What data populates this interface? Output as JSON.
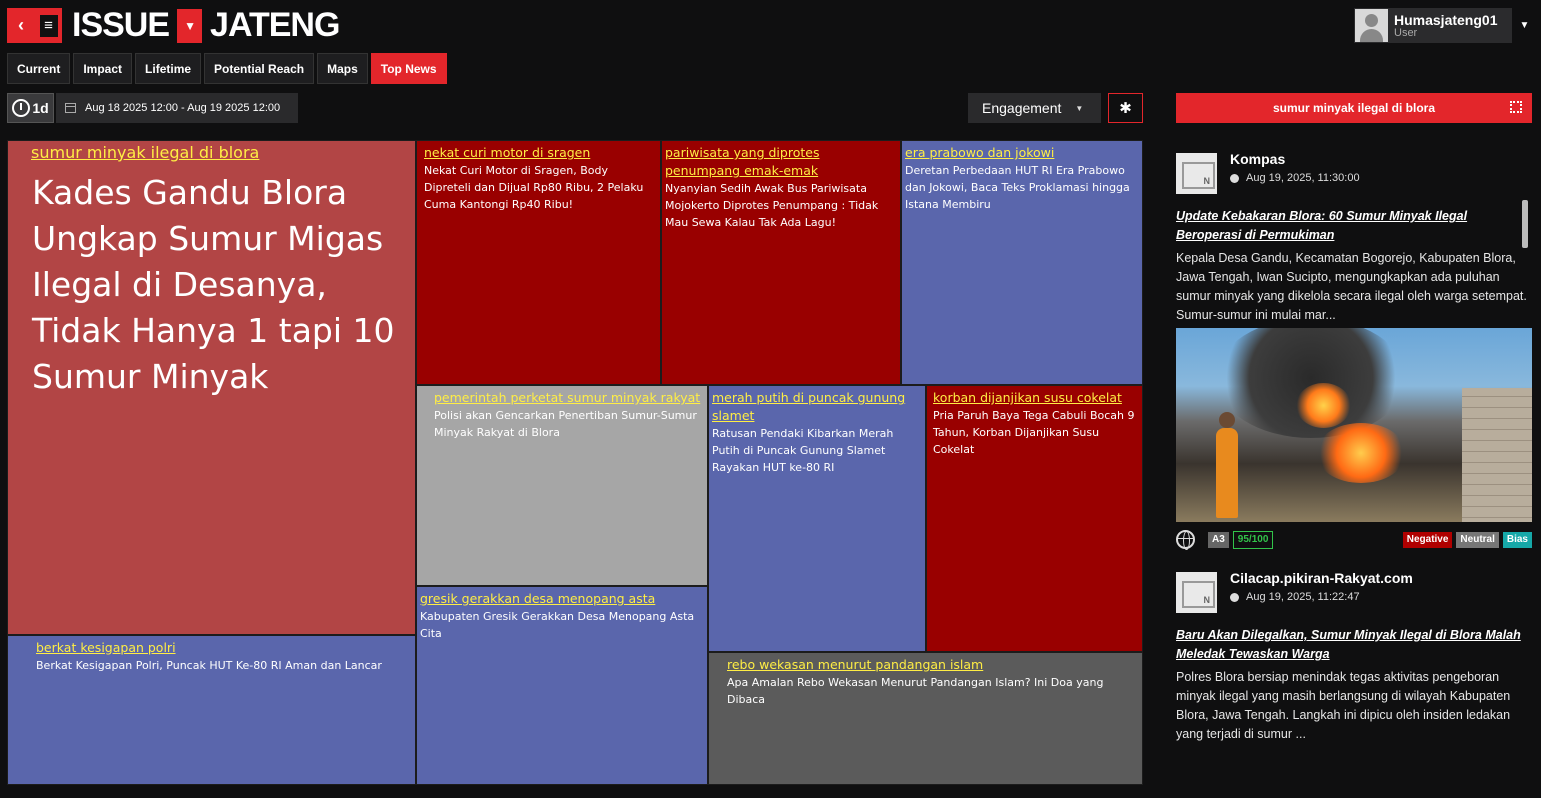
{
  "header": {
    "back_icon": "back-arrow-icon",
    "menu_icon": "hamburger-menu-icon",
    "logo_left": "ISSUE",
    "logo_right": "JATENG",
    "user_name": "Humasjateng01",
    "user_role": "User"
  },
  "tabs": [
    {
      "label": "Current",
      "active": false
    },
    {
      "label": "Impact",
      "active": false
    },
    {
      "label": "Lifetime",
      "active": false
    },
    {
      "label": "Potential Reach",
      "active": false
    },
    {
      "label": "Maps",
      "active": false
    },
    {
      "label": "Top News",
      "active": true
    }
  ],
  "toolbar": {
    "period": "1d",
    "date_range": "Aug 18 2025 12:00  - Aug 19 2025 12:00",
    "metric": "Engagement"
  },
  "treemap": [
    {
      "keyword": "sumur minyak ilegal di blora",
      "headline": "Kades Gandu Blora Ungkap Sumur Migas Ilegal di Desanya, Tidak Hanya 1 tapi 10 Sumur Minyak",
      "color": "#b24545"
    },
    {
      "keyword": "nekat curi motor di sragen",
      "headline": "Nekat Curi Motor di Sragen, Body Dipreteli dan Dijual Rp80 Ribu, 2 Pelaku Cuma Kantongi Rp40 Ribu!",
      "color": "#990000"
    },
    {
      "keyword": "pariwisata yang diprotes penumpang emak-emak",
      "headline": "Nyanyian Sedih Awak Bus Pariwisata Mojokerto Diprotes Penumpang : Tidak Mau Sewa Kalau Tak Ada Lagu!",
      "color": "#990000"
    },
    {
      "keyword": "era prabowo dan jokowi",
      "headline": "Deretan Perbedaan HUT RI Era Prabowo dan Jokowi, Baca Teks Proklamasi hingga Istana Membiru",
      "color": "#5a66ac"
    },
    {
      "keyword": "pemerintah perketat sumur minyak rakyat",
      "headline": "Polisi akan Gencarkan Penertiban Sumur-Sumur Minyak Rakyat di Blora",
      "color": "#a6a6a6"
    },
    {
      "keyword": "merah putih di puncak gunung slamet",
      "headline": "Ratusan Pendaki Kibarkan Merah Putih di Puncak Gunung Slamet Rayakan HUT ke-80 RI",
      "color": "#5a66ac"
    },
    {
      "keyword": "korban dijanjikan susu cokelat",
      "headline": "Pria Paruh Baya Tega Cabuli Bocah 9 Tahun, Korban Dijanjikan Susu Cokelat",
      "color": "#990000"
    },
    {
      "keyword": "berkat kesigapan polri",
      "headline": "Berkat Kesigapan Polri, Puncak HUT Ke-80 RI Aman dan Lancar",
      "color": "#5a66ac"
    },
    {
      "keyword": "gresik gerakkan desa menopang asta",
      "headline": "Kabupaten Gresik Gerakkan Desa Menopang Asta Cita",
      "color": "#5a66ac"
    },
    {
      "keyword": "rebo wekasan menurut pandangan islam",
      "headline": "Apa Amalan Rebo Wekasan Menurut Pandangan Islam? Ini Doa yang Dibaca",
      "color": "#5b5b5b"
    }
  ],
  "panel": {
    "title": "sumur minyak ilegal di blora",
    "news": [
      {
        "source": "Kompas",
        "time": "Aug 19, 2025, 11:30:00",
        "title": "Update Kebakaran Blora: 60 Sumur Minyak Ilegal Beroperasi di Permukiman",
        "body": "Kepala Desa Gandu, Kecamatan Bogorejo, Kabupaten Blora, Jawa Tengah, Iwan Sucipto, mengungkapkan ada puluhan sumur minyak yang dikelola secara ilegal oleh warga setempat. Sumur-sumur ini mulai mar...",
        "tier": "A3",
        "score": "95/100",
        "tags": [
          "Negative",
          "Neutral",
          "Bias"
        ]
      },
      {
        "source": "Cilacap.pikiran-Rakyat.com",
        "time": "Aug 19, 2025, 11:22:47",
        "title": "Baru Akan Dilegalkan, Sumur Minyak Ilegal di Blora Malah Meledak Tewaskan Warga",
        "body": "Polres Blora bersiap menindak tegas aktivitas pengeboran minyak ilegal yang masih berlangsung di wilayah Kabupaten Blora, Jawa Tengah. Langkah ini dipicu oleh insiden ledakan yang terjadi di sumur ..."
      }
    ]
  }
}
